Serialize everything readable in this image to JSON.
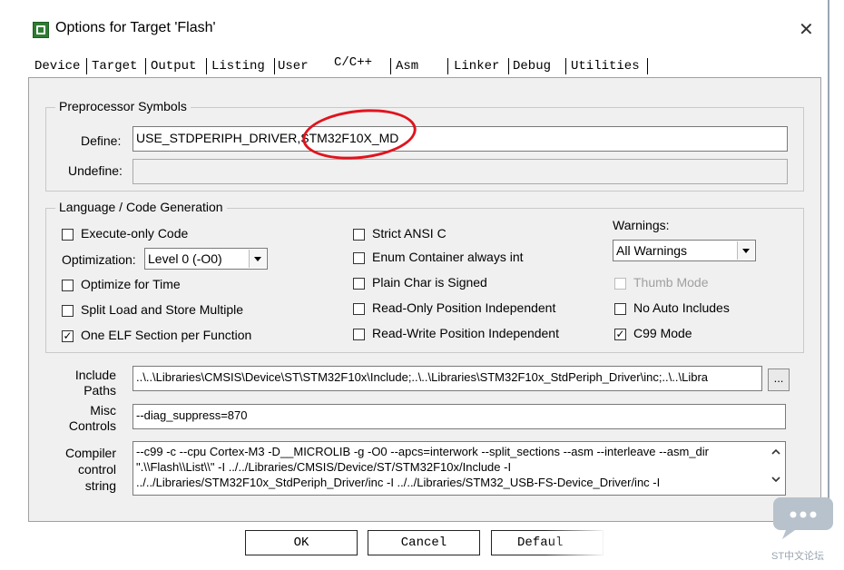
{
  "window": {
    "title": "Options for Target 'Flash'",
    "close_glyph": "✕"
  },
  "tabs": [
    "Device",
    "Target",
    "Output",
    "Listing",
    "User",
    "C/C++",
    "Asm",
    "Linker",
    "Debug",
    "Utilities"
  ],
  "active_tab": "C/C++",
  "preprocessor": {
    "legend": "Preprocessor Symbols",
    "define_label": "Define:",
    "define_value": "USE_STDPERIPH_DRIVER,STM32F10X_MD",
    "undefine_label": "Undefine:",
    "undefine_value": ""
  },
  "language": {
    "legend": "Language / Code Generation",
    "execute_only": {
      "label": "Execute-only Code",
      "checked": false
    },
    "optimization_label": "Optimization:",
    "optimization_value": "Level 0 (-O0)",
    "optimize_time": {
      "label": "Optimize for Time",
      "checked": false
    },
    "split_load": {
      "label": "Split Load and Store Multiple",
      "checked": false
    },
    "one_elf": {
      "label": "One ELF Section per Function",
      "checked": true
    },
    "strict_ansi": {
      "label": "Strict ANSI C",
      "checked": false
    },
    "enum_container": {
      "label": "Enum Container always int",
      "checked": false
    },
    "plain_char": {
      "label": "Plain Char is Signed",
      "checked": false
    },
    "ro_position": {
      "label": "Read-Only Position Independent",
      "checked": false
    },
    "rw_position": {
      "label": "Read-Write Position Independent",
      "checked": false
    },
    "warnings_label": "Warnings:",
    "warnings_value": "All Warnings",
    "thumb_mode": {
      "label": "Thumb Mode",
      "checked": false,
      "disabled": true
    },
    "no_auto_includes": {
      "label": "No Auto Includes",
      "checked": false
    },
    "c99_mode": {
      "label": "C99 Mode",
      "checked": true
    }
  },
  "include_paths": {
    "label_line1": "Include",
    "label_line2": "Paths",
    "value": "..\\..\\Libraries\\CMSIS\\Device\\ST\\STM32F10x\\Include;..\\..\\Libraries\\STM32F10x_StdPeriph_Driver\\inc;..\\..\\Libra",
    "browse_label": "..."
  },
  "misc_controls": {
    "label_line1": "Misc",
    "label_line2": "Controls",
    "value": "--diag_suppress=870"
  },
  "compiler_control": {
    "label_line1": "Compiler",
    "label_line2": "control",
    "label_line3": "string",
    "line1": "--c99 -c --cpu Cortex-M3 -D__MICROLIB -g -O0 --apcs=interwork --split_sections --asm --interleave --asm_dir",
    "line2": "\".\\\\Flash\\\\List\\\\\" -I ../../Libraries/CMSIS/Device/ST/STM32F10x/Include -I",
    "line3": "../../Libraries/STM32F10x_StdPeriph_Driver/inc -I ../../Libraries/STM32_USB-FS-Device_Driver/inc -I"
  },
  "buttons": {
    "ok": "OK",
    "cancel": "Cancel",
    "defaults": "Defaul"
  },
  "watermark": {
    "text": "ST中文论坛",
    "badge_text": "•••"
  },
  "colors": {
    "annotation_red": "#e0141e",
    "icon_green": "#2e7d32",
    "watermark": "#9aa4b0"
  }
}
